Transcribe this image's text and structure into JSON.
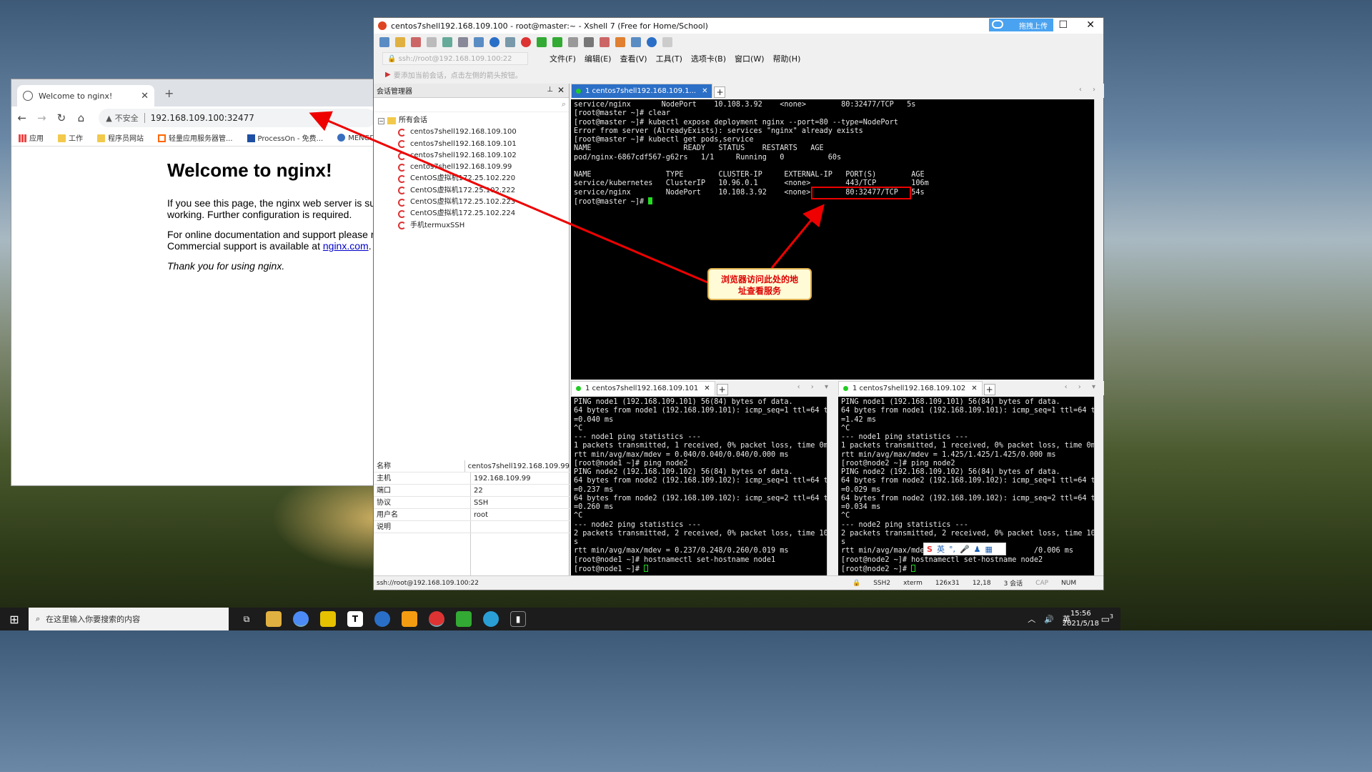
{
  "browser": {
    "tab_title": "Welcome to nginx!",
    "not_secure": "不安全",
    "url": "192.168.109.100:32477",
    "bookmarks": [
      "应用",
      "工作",
      "程序员网站",
      "轻量应用服务器管...",
      "ProcessOn - 免费...",
      "MENGDI-C"
    ],
    "page": {
      "heading": "Welcome to nginx!",
      "p1_line1": "If you see this page, the nginx web server is succ",
      "p1_line2": "working. Further configuration is required.",
      "p2_line1": "For online documentation and support please refe",
      "p2_line2_prefix": "Commercial support is available at ",
      "p2_link": "nginx.com",
      "p2_line2_suffix": ".",
      "p3": "Thank you for using nginx."
    }
  },
  "xshell": {
    "title": "centos7shell192.168.109.100 - root@master:~ - Xshell 7 (Free for Home/School)",
    "upload_label": "拖拽上传",
    "address": "ssh://root@192.168.109.100:22",
    "menu": [
      "文件(F)",
      "编辑(E)",
      "查看(V)",
      "工具(T)",
      "选项卡(B)",
      "窗口(W)",
      "帮助(H)"
    ],
    "hint": "要添加当前会话，点击左侧的箭头按钮。",
    "session_manager": {
      "title": "会话管理器",
      "root": "所有会话",
      "sessions": [
        "centos7shell192.168.109.100",
        "centos7shell192.168.109.101",
        "centos7shell192.168.109.102",
        "centos7shell192.168.109.99",
        "CentOS虚拟机172.25.102.220",
        "CentOS虚拟机172.25.102.222",
        "CentOS虚拟机172.25.102.223",
        "CentOS虚拟机172.25.102.224",
        "手机termuxSSH"
      ],
      "properties": [
        {
          "k": "名称",
          "v": "centos7shell192.168.109.99"
        },
        {
          "k": "主机",
          "v": "192.168.109.99"
        },
        {
          "k": "端口",
          "v": "22"
        },
        {
          "k": "协议",
          "v": "SSH"
        },
        {
          "k": "用户名",
          "v": "root"
        },
        {
          "k": "说明",
          "v": ""
        }
      ]
    },
    "tabs": {
      "main": "1 centos7shell192.168.109.1...",
      "bottom_left": "1 centos7shell192.168.109.101",
      "bottom_right": "1 centos7shell192.168.109.102"
    },
    "main_terminal": [
      "service/nginx       NodePort    10.108.3.92    <none>        80:32477/TCP   5s",
      "[root@master ~]# clear",
      "[root@master ~]# kubectl expose deployment nginx --port=80 --type=NodePort",
      "Error from server (AlreadyExists): services \"nginx\" already exists",
      "[root@master ~]# kubectl get pods,service",
      "NAME                     READY   STATUS    RESTARTS   AGE",
      "pod/nginx-6867cdf567-g62rs   1/1     Running   0          60s",
      "",
      "NAME                 TYPE        CLUSTER-IP     EXTERNAL-IP   PORT(S)        AGE",
      "service/kubernetes   ClusterIP   10.96.0.1      <none>        443/TCP        106m",
      "service/nginx        NodePort    10.108.3.92    <none>        80:32477/TCP   54s"
    ],
    "main_prompt": "[root@master ~]# ",
    "left_terminal": [
      "PING node1 (192.168.109.101) 56(84) bytes of data.",
      "64 bytes from node1 (192.168.109.101): icmp_seq=1 ttl=64 time",
      "=0.040 ms",
      "^C",
      "--- node1 ping statistics ---",
      "1 packets transmitted, 1 received, 0% packet loss, time 0ms",
      "rtt min/avg/max/mdev = 0.040/0.040/0.040/0.000 ms",
      "[root@node1 ~]# ping node2",
      "PING node2 (192.168.109.102) 56(84) bytes of data.",
      "64 bytes from node2 (192.168.109.102): icmp_seq=1 ttl=64 time",
      "=0.237 ms",
      "64 bytes from node2 (192.168.109.102): icmp_seq=2 ttl=64 time",
      "=0.260 ms",
      "^C",
      "--- node2 ping statistics ---",
      "2 packets transmitted, 2 received, 0% packet loss, time 1000m",
      "s",
      "rtt min/avg/max/mdev = 0.237/0.248/0.260/0.019 ms",
      "[root@node1 ~]# hostnamectl set-hostname node1"
    ],
    "left_prompt": "[root@node1 ~]# ",
    "right_terminal": [
      "PING node1 (192.168.109.101) 56(84) bytes of data.",
      "64 bytes from node1 (192.168.109.101): icmp_seq=1 ttl=64 time",
      "=1.42 ms",
      "^C",
      "--- node1 ping statistics ---",
      "1 packets transmitted, 1 received, 0% packet loss, time 0ms",
      "rtt min/avg/max/mdev = 1.425/1.425/1.425/0.000 ms",
      "[root@node2 ~]# ping node2",
      "PING node2 (192.168.109.102) 56(84) bytes of data.",
      "64 bytes from node2 (192.168.109.102): icmp_seq=1 ttl=64 time",
      "=0.029 ms",
      "64 bytes from node2 (192.168.109.102): icmp_seq=2 ttl=64 time",
      "=0.034 ms",
      "^C",
      "--- node2 ping statistics ---",
      "2 packets transmitted, 2 received, 0% packet loss, time 1000m",
      "s",
      "rtt min/avg/max/mdev                        /0.006 ms",
      "[root@node2 ~]# hostnamectl set-hostname node2"
    ],
    "right_prompt": "[root@node2 ~]# ",
    "status": {
      "address": "ssh://root@192.168.109.100:22",
      "protocol": "SSH2",
      "term": "xterm",
      "size": "126x31",
      "pos": "12,18",
      "sessions": "3 会话",
      "cap": "CAP",
      "num": "NUM"
    }
  },
  "annotation": {
    "callout_line1": "浏览器访问此处的地",
    "callout_line2": "址查看服务"
  },
  "ime": {
    "lang": "英"
  },
  "taskbar": {
    "search_placeholder": "在这里输入你要搜索的内容",
    "time": "15:56",
    "date": "2021/5/18",
    "ime": "英",
    "notif_count": "3"
  }
}
